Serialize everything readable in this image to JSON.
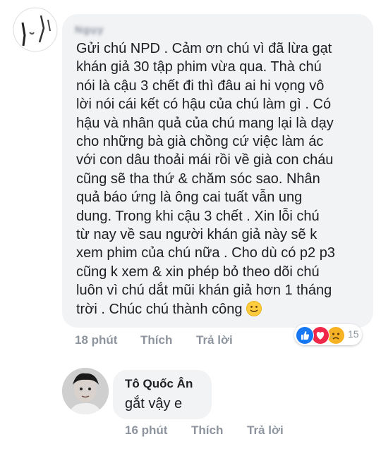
{
  "comment1": {
    "author": "Ngụy",
    "text": "Gửi chú NPD . Cảm ơn chú vì đã lừa gạt\nkhán giả 30 tập phim vừa qua.  Thà chú\nnói là cậu 3 chết đi thì đâu ai hi vọng vô\nlời nói cái kết có hậu của chú làm gì . Có\nhậu và nhân quả của chú mang lại là dạy\ncho những bà già chồng cứ việc làm ác\nvới con dâu thoải mái rồi về già con cháu\ncũng sẽ tha thứ & chăm sóc sao.  Nhân\nquả báo ứng là ông cai tuất vẫn ung\ndung.  Trong khi cậu 3 chết . Xin lỗi chú\ntừ nay về sau người khán giả này sẽ k\nxem phim của chú nữa . Cho dù có p2 p3\ncũng k xem & xin phép bỏ theo dõi chú\nluôn vì chú dắt mũi khán giả hơn 1 tháng\ntrời . Chúc chú thành công",
    "emoji": "smiling-face",
    "time": "18 phút",
    "like_label": "Thích",
    "reply_label": "Trả lời",
    "reaction_count": "15",
    "reactions": [
      "like",
      "love",
      "sad"
    ]
  },
  "comment2": {
    "author": "Tô Quốc Ân",
    "text": "gắt vậy e",
    "time": "16 phút",
    "like_label": "Thích",
    "reply_label": "Trả lời"
  },
  "colors": {
    "bubble": "#f2f3f5",
    "meta_text": "#8d949e",
    "body_text": "#1c1e21",
    "like_blue": "#1877f2",
    "love_red": "#f0284a",
    "sad_yellow": "#f7b125"
  }
}
